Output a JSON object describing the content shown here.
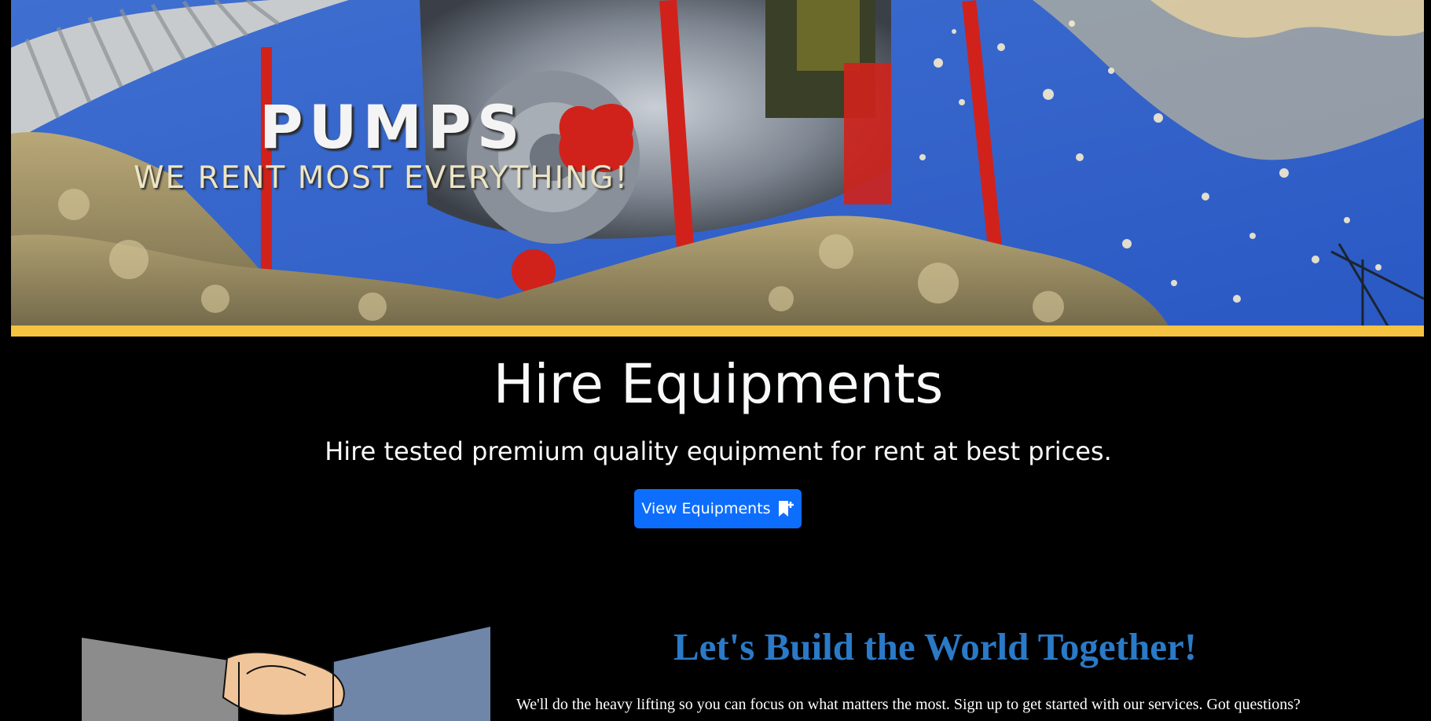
{
  "banner": {
    "title": "PUMPS",
    "tagline": "WE RENT MOST EVERYTHING!",
    "accent_color": "#f5c242"
  },
  "hero": {
    "title": "Hire Equipments",
    "lead": "Hire tested premium quality equipment for rent at best prices.",
    "cta_label": "View Equipments",
    "cta_icon": "bookmark-plus-icon",
    "cta_color": "#0d6efd"
  },
  "about": {
    "heading": "Let's Build the World Together!",
    "heading_color": "#2a7ac7",
    "text": "We'll do the heavy lifting so you can focus on what matters the most. Sign up to get started with our services. Got questions?",
    "image": "handshake-illustration"
  }
}
